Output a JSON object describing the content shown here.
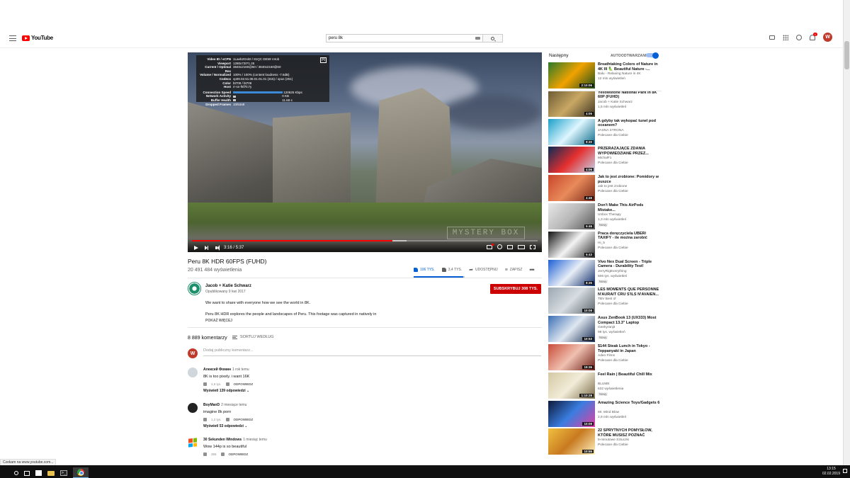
{
  "search": {
    "query": "peru 8k"
  },
  "masthead": {
    "logo_text": "YouTube",
    "notif_count": "1",
    "avatar_letter": "W"
  },
  "player": {
    "watermark": "MYSTERY BOX",
    "time": "3:16 / 5:37",
    "played_fraction": 0.58,
    "buffered_fraction": 0.62,
    "stats": [
      {
        "k": "Video ID / sCPN",
        "v": "1Laeb2Gsk0 / 81QC DE59 V4ob"
      },
      {
        "k": "Viewport",
        "v": "1280x720*1.25"
      },
      {
        "k": "Current / Optimal Res",
        "v": "3840x2160@60 / 3840x2160@60"
      },
      {
        "k": "Volume / Normalized",
        "v": "100% / 100% (content loudness -7.6dB)"
      },
      {
        "k": "Codecs",
        "v": "vp09.02.51.08.01.01.01 (315) / opus (251)"
      },
      {
        "k": "Color",
        "v": "bt709 / bt709"
      },
      {
        "k": "Host",
        "v": "rr-sn-f5f7lc7y"
      },
      {
        "k": "Connection Speed",
        "v": "120625 Kbps"
      },
      {
        "k": "Network Activity",
        "v": "0 KB"
      },
      {
        "k": "Buffer Health",
        "v": "11.68 s"
      },
      {
        "k": "Dropped Frames",
        "v": "10/5348"
      }
    ],
    "stats_close": "[x]"
  },
  "video": {
    "title": "Peru 8K HDR 60FPS (FUHD)",
    "views": "20 491 484 wyświetlenia",
    "likes": "106 TYS.",
    "dislikes": "3,4 TYS.",
    "share": "UDOSTĘPNIJ",
    "save": "ZAPISZ",
    "like_ratio": 0.97
  },
  "channel": {
    "name": "Jacob + Katie Schwarz",
    "published": "Opublikowany 9 kwi 2017",
    "subscribe": "SUBSKRYBUJ  308 TYS."
  },
  "description": {
    "line1": "We want to share with everyone how we see the world in 8K.",
    "line2": "Peru 8K HDR explores the people and landscapes of Peru. This footage was captured in natively in",
    "show_more": "POKAŻ WIĘCEJ"
  },
  "comments": {
    "count": "8 889 komentarzy",
    "sort": "SORTUJ WEDŁUG",
    "add_placeholder": "Dodaj publiczny komentarz...",
    "items": [
      {
        "author": "Алексей Фомин",
        "time": "1 rok temu",
        "text": "8K is too pixely. i want 16K",
        "likes": "4,9 tys.",
        "reply": "ODPOWIEDZ",
        "replies": "Wyświetl 139 odpowiedzi"
      },
      {
        "author": "BoyManD",
        "time": "2 miesiące temu",
        "text": "imagine 8k porn",
        "likes": "1,2 tys.",
        "reply": "ODPOWIEDZ",
        "replies": "Wyświetl 53 odpowiedzi"
      },
      {
        "author": "30 Sekunden Windows",
        "time": "1 miesiąc temu",
        "text": "Wow 144p is so beautiful",
        "likes": "355",
        "reply": "ODPOWIEDZ",
        "replies": ""
      }
    ]
  },
  "sidebar": {
    "title": "Następny",
    "autoplay": "AUTOODTWARZANIE",
    "recs": [
      {
        "title": "Breathtaking Colors of Nature in 4K III 🦜 Beautiful Nature -...",
        "channel": "Balu - Relaxing Nature in 4K",
        "meta": "12 mln wyświetleń",
        "new": "",
        "duration": "2:10:06",
        "colors": [
          "#2a7a2a",
          "#f2a200",
          "#1b4d1b"
        ]
      },
      {
        "title": "Yellowstone National Park in 8K 60P (FUHD)",
        "channel": "Jacob + Katie Schwarz",
        "meta": "1,5 mln wyświetleń",
        "new": "",
        "duration": "4:05",
        "colors": [
          "#6b5a33",
          "#c9a864",
          "#3c3422"
        ]
      },
      {
        "title": "A gdyby tak wykopać tunel pod oceanem?",
        "channel": "JASNA STRONA",
        "meta": "Polecane dla Ciebie",
        "new": "",
        "duration": "9:30",
        "colors": [
          "#19a0c8",
          "#dff6ff",
          "#0c6b8a"
        ]
      },
      {
        "title": "PRZERAŻAJĄCE ZDANIA WYPOWIEDZIANE PRZEZ...",
        "channel": "MichalF1",
        "meta": "Polecane dla Ciebie",
        "new": "",
        "duration": "4:06",
        "colors": [
          "#0a2c55",
          "#e52f2f",
          "#c4d6ec"
        ]
      },
      {
        "title": "Jak to jest zrobione: Pomidory w puszce",
        "channel": "Jak to jest zrobione",
        "meta": "Polecane dla Ciebie",
        "new": "",
        "duration": "4:46",
        "colors": [
          "#c9462c",
          "#e88a5a",
          "#7a2a1a"
        ]
      },
      {
        "title": "Don't Make This AirPods Mistake...",
        "channel": "Unbox Therapy",
        "meta": "1,3 mln wyświetleń",
        "new": "Nowy",
        "duration": "5:46",
        "colors": [
          "#e8e8e8",
          "#b8b8b8",
          "#555555"
        ]
      },
      {
        "title": "Praca doręczyciela UBER/ TAXIFY - ile można zarobić jeżdżąc 2h...",
        "channel": "Hi_5",
        "meta": "Polecane dla Ciebie",
        "new": "",
        "duration": "5:43",
        "colors": [
          "#111111",
          "#f4f4f4",
          "#2b2b2b"
        ]
      },
      {
        "title": "Vivo Nex Dual Screen - Triple Camera - Durability Test!",
        "channel": "JerryRigEverything",
        "meta": "506 tys. wyświetleń",
        "new": "Nowy",
        "duration": "8:35",
        "colors": [
          "#1d5fd4",
          "#e8eef7",
          "#0d2a66"
        ]
      },
      {
        "title": "LES MOMENTS QUE PERSONNE N'AURAIT CRU S'ILS N'AVAIEN...",
        "channel": "TBV Best of",
        "meta": "Polecane dla Ciebie",
        "new": "",
        "duration": "10:08",
        "colors": [
          "#9ca7b0",
          "#d7dde2",
          "#5c656c"
        ]
      },
      {
        "title": "Asus ZenBook 13 (UX333) Most Compact 13.3\" Laptop",
        "channel": "Geekyranjit",
        "meta": "98 tys. wyświetleń",
        "new": "Nowy",
        "duration": "10:53",
        "colors": [
          "#3b6fb6",
          "#dfe7f0",
          "#1a2f55"
        ]
      },
      {
        "title": "$144 Steak Lunch in Tokyo - Teppanyaki in Japan",
        "channel": "Aden Films",
        "meta": "Polecane dla Ciebie",
        "new": "",
        "duration": "19:36",
        "colors": [
          "#c94c3a",
          "#f0c0b0",
          "#6a1e14"
        ]
      },
      {
        "title": "Feel Rain | Beautiful Chill Mix",
        "channel": "BLUME",
        "meta": "632 wyświetlenia",
        "new": "Nowy",
        "duration": "1:10:28",
        "colors": [
          "#d4c8a4",
          "#f2ecd8",
          "#7a6c48"
        ]
      },
      {
        "title": "Amazing Science Toys/Gadgets 6",
        "channel": "Mr. Mind Blow",
        "meta": "2,9 mln wyświetleń",
        "new": "",
        "duration": "10:08",
        "colors": [
          "#0d1a3a",
          "#3a7de0",
          "#e040a0"
        ]
      },
      {
        "title": "22 SPRYTNYCH POMYSŁÓW, KTÓRE MUSISZ POZNAĆ",
        "channel": "5-minutowe Sztuczki",
        "meta": "Polecane dla Ciebie",
        "new": "",
        "duration": "10:55",
        "colors": [
          "#f0c040",
          "#c87a20",
          "#fff3c0"
        ]
      }
    ]
  },
  "statusbar": {
    "url": "Czekam na www.youtube.com..."
  },
  "taskbar": {
    "time": "13:15",
    "date": "02.02.2019",
    "cmd_glyph": ">_"
  }
}
